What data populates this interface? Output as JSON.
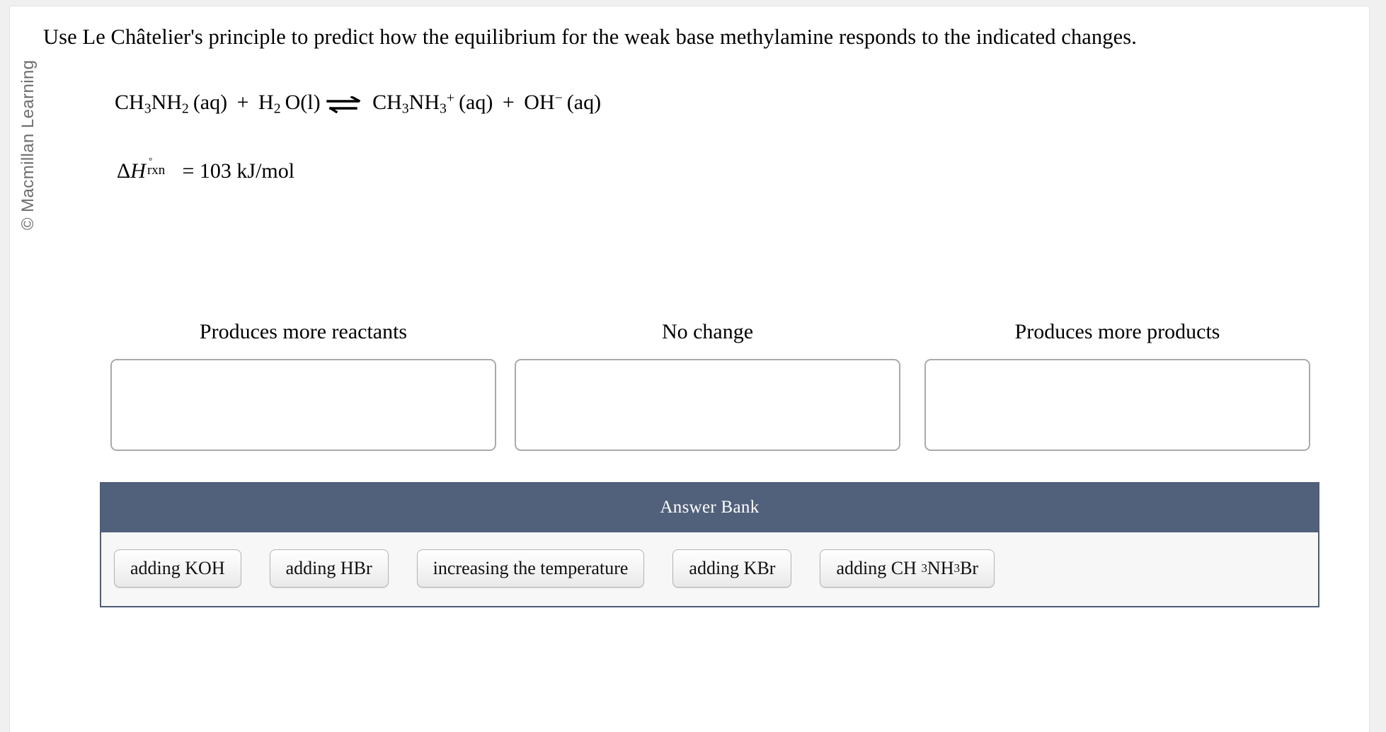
{
  "watermark": {
    "text": "© Macmillan Learning"
  },
  "prompt": {
    "text": "Use Le Châtelier's principle to predict how the equilibrium for the weak base methylamine responds to the indicated changes."
  },
  "equation": {
    "reactant_1_formula": "CH",
    "reactant_1_sub_a": "3",
    "reactant_1_mid": "NH",
    "reactant_1_sub_b": "2",
    "reactant_1_state": "(aq)",
    "plus_1": "+",
    "reactant_2_formula": "H",
    "reactant_2_sub": "2",
    "reactant_2_mid": "O",
    "reactant_2_state": "(l)",
    "arrow": "equilibrium-arrow",
    "product_1_formula": "CH",
    "product_1_sub_a": "3",
    "product_1_mid": "NH",
    "product_1_sub_b": "3",
    "product_1_charge": "+",
    "product_1_state": "(aq)",
    "plus_2": "+",
    "product_2_formula": "OH",
    "product_2_charge": "−",
    "product_2_state": "(aq)",
    "plain_text": "CH3NH2(aq) + H2O(l) ⇌ CH3NH3+(aq) + OH−(aq)"
  },
  "enthalpy": {
    "delta": "Δ",
    "symbol": "H",
    "degree": "°",
    "subscript": "rxn",
    "equals": "=",
    "value": "103 kJ/mol",
    "plain_text": "ΔH°rxn = 103 kJ/mol"
  },
  "drop_zones": [
    {
      "label": "Produces more reactants",
      "contents": []
    },
    {
      "label": "No change",
      "contents": []
    },
    {
      "label": "Produces more products",
      "contents": []
    }
  ],
  "answer_bank": {
    "title": "Answer Bank",
    "header_color": "#51607b",
    "border_color": "#4e5d77",
    "items": [
      {
        "label": "adding KOH"
      },
      {
        "label": "adding HBr"
      },
      {
        "label": "increasing the temperature"
      },
      {
        "label": "adding KBr"
      },
      {
        "label": "adding CH3NH3Br"
      }
    ],
    "item_4_rich": {
      "prefix": "adding CH",
      "sub_a": "3",
      "mid": "NH",
      "sub_b": "3",
      "suffix": "Br"
    }
  }
}
